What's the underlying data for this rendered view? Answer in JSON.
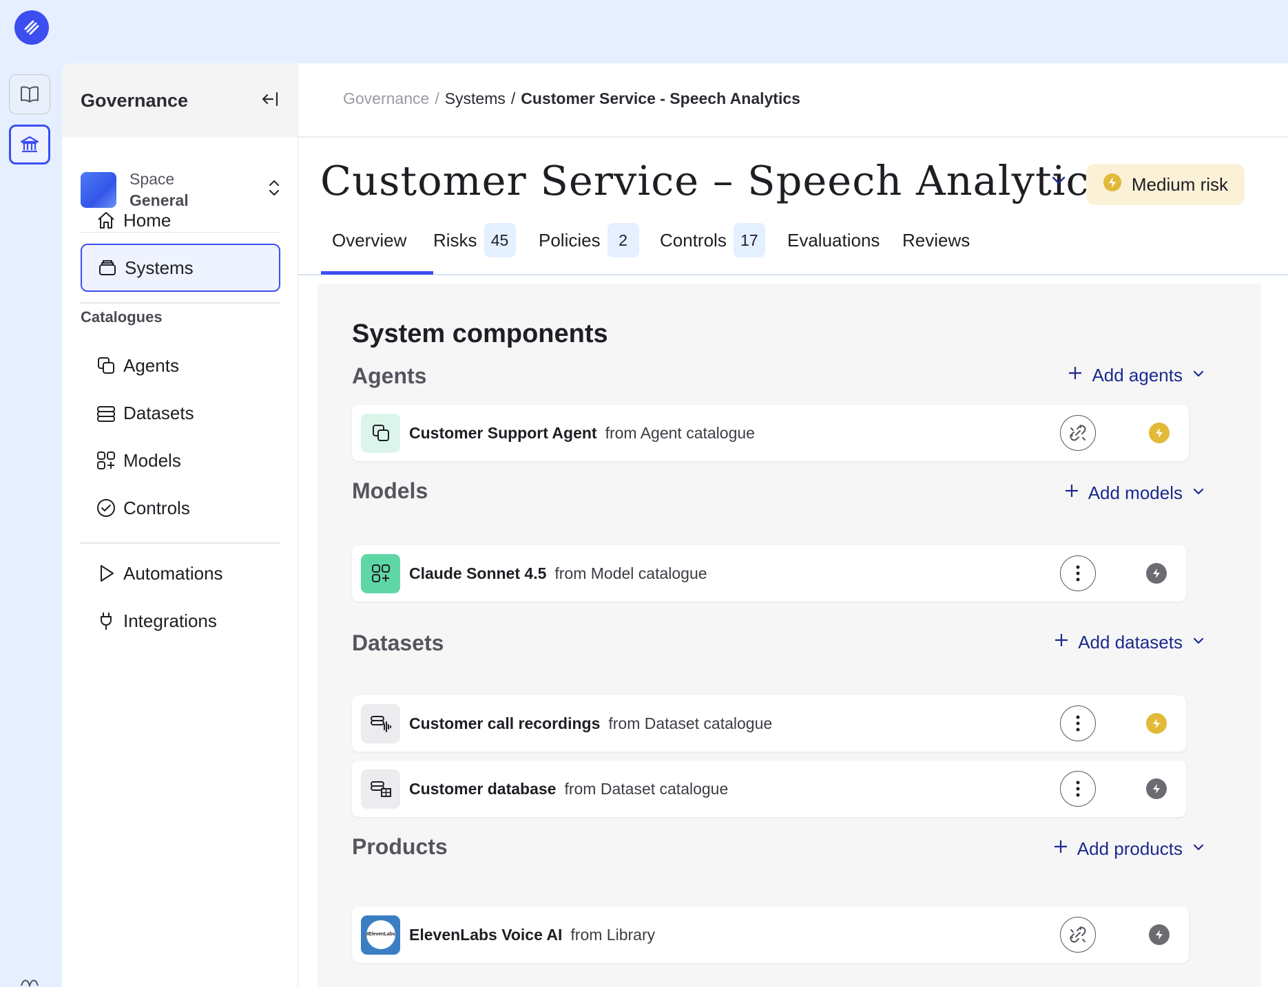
{
  "sidebar": {
    "title": "Governance",
    "space": {
      "label": "Space",
      "name": "General"
    },
    "nav": [
      {
        "label": "Home",
        "icon": "home-icon"
      },
      {
        "label": "Systems",
        "icon": "systems-icon",
        "active": true
      }
    ],
    "catalogues_heading": "Catalogues",
    "catalogues": [
      {
        "label": "Agents",
        "icon": "agents-icon"
      },
      {
        "label": "Datasets",
        "icon": "datasets-icon"
      },
      {
        "label": "Models",
        "icon": "models-icon"
      },
      {
        "label": "Controls",
        "icon": "controls-icon"
      }
    ],
    "extra": [
      {
        "label": "Automations",
        "icon": "play-icon"
      },
      {
        "label": "Integrations",
        "icon": "plug-icon"
      }
    ]
  },
  "breadcrumb": {
    "root": "Governance",
    "sep1": "/",
    "section": "Systems",
    "sep2": "/",
    "current": "Customer Service - Speech Analytics"
  },
  "page": {
    "title": "Customer Service – Speech Analytics",
    "risk": "Medium risk"
  },
  "tabs": [
    {
      "label": "Overview",
      "count": null,
      "active": true
    },
    {
      "label": "Risks",
      "count": "45"
    },
    {
      "label": "Policies",
      "count": "2"
    },
    {
      "label": "Controls",
      "count": "17"
    },
    {
      "label": "Evaluations",
      "count": null
    },
    {
      "label": "Reviews",
      "count": null
    }
  ],
  "components": {
    "title": "System components",
    "agents": {
      "title": "Agents",
      "add_label": "Add agents",
      "items": [
        {
          "name": "Customer Support Agent",
          "source": "from Agent catalogue",
          "status": "medium"
        }
      ]
    },
    "models": {
      "title": "Models",
      "add_label": "Add models",
      "items": [
        {
          "name": "Claude Sonnet 4.5",
          "source": "from Model catalogue",
          "status": "none"
        }
      ]
    },
    "datasets": {
      "title": "Datasets",
      "add_label": "Add datasets",
      "items": [
        {
          "name": "Customer call recordings",
          "source": "from Dataset catalogue",
          "status": "medium"
        },
        {
          "name": "Customer database",
          "source": "from Dataset catalogue",
          "status": "none"
        }
      ]
    },
    "products": {
      "title": "Products",
      "add_label": "Add products",
      "items": [
        {
          "name": "ElevenLabs Voice AI",
          "source": "from Library",
          "status": "none",
          "logo_text": "IIElevenLabs"
        }
      ]
    }
  },
  "colors": {
    "accent": "#3d4ef0",
    "risk_medium": "#e2b938",
    "status_none": "#6b6b72",
    "agent_icon_bg": "#dbf5ea",
    "model_icon_bg": "#5fd6a6",
    "dataset_icon_bg": "#ececef",
    "product_icon_bg": "#3a7fc4"
  }
}
